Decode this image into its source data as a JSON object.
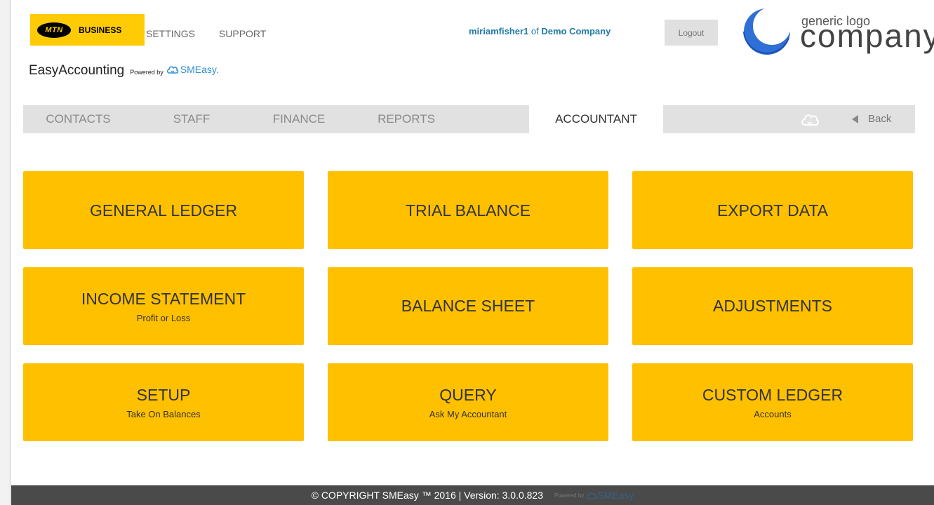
{
  "brand": {
    "mtn": "MTN",
    "business": "BUSINESS",
    "app_name": "EasyAccounting",
    "powered_by": "Powered by",
    "smeasy": "SMEasy."
  },
  "topnav": [
    "SETTINGS",
    "SUPPORT"
  ],
  "user": {
    "username": "miriamfisher1",
    "of": "of",
    "company": "Demo Company",
    "logout": "Logout"
  },
  "company_logo": {
    "small": "generic logo",
    "big": "company"
  },
  "tabs": [
    {
      "label": "CONTACTS"
    },
    {
      "label": "STAFF"
    },
    {
      "label": "FINANCE"
    },
    {
      "label": "REPORTS"
    },
    {
      "label": "ACCOUNTANT"
    }
  ],
  "back_label": "Back",
  "tiles": [
    {
      "title": "GENERAL LEDGER",
      "subtitle": ""
    },
    {
      "title": "TRIAL BALANCE",
      "subtitle": ""
    },
    {
      "title": "EXPORT DATA",
      "subtitle": ""
    },
    {
      "title": "INCOME STATEMENT",
      "subtitle": "Profit or Loss"
    },
    {
      "title": "BALANCE SHEET",
      "subtitle": ""
    },
    {
      "title": "ADJUSTMENTS",
      "subtitle": ""
    },
    {
      "title": "SETUP",
      "subtitle": "Take On Balances"
    },
    {
      "title": "QUERY",
      "subtitle": "Ask My Accountant"
    },
    {
      "title": "CUSTOM LEDGER",
      "subtitle": "Accounts"
    }
  ],
  "footer": {
    "copyright": "© COPYRIGHT SMEasy ™ 2016 | Version: 3.0.0.823",
    "powered_by": "Powered by",
    "smeasy": "SMEasy"
  },
  "colors": {
    "tile": "#ffc000",
    "mtn_yellow": "#ffcb05",
    "tabbar": "#e1e1e1",
    "footer": "#4a4a4a",
    "link_blue": "#1f7ba8"
  }
}
